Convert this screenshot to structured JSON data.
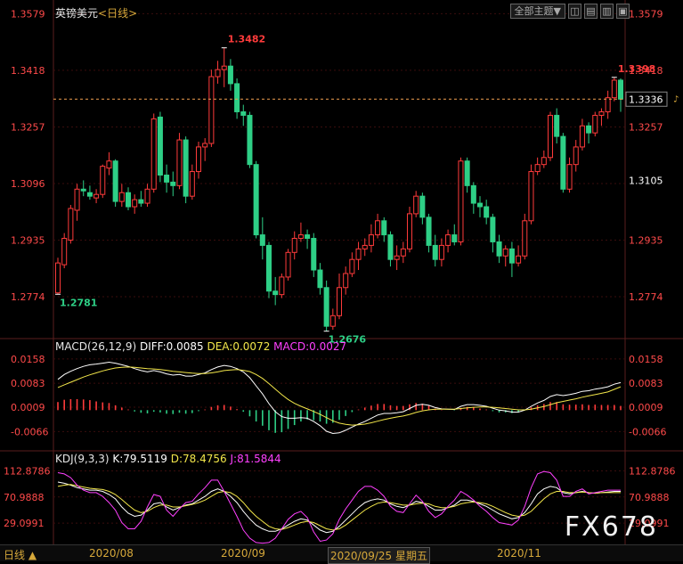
{
  "header": {
    "symbol": "英镑美元",
    "period": "<日线>",
    "theme_button": "全部主题▼",
    "buttons": [
      "◫",
      "▤",
      "▥",
      "▣"
    ]
  },
  "macd_header": {
    "name": "MACD(26,12,9)",
    "diff": "DIFF:0.0085",
    "dea": "DEA:0.0072",
    "macd": "MACD:0.0027"
  },
  "kdj_header": {
    "name": "KDJ(9,3,3)",
    "k": "K:79.5119",
    "d": "D:78.4756",
    "j": "J:81.5844"
  },
  "bottom": {
    "period_label": "日线 ▲",
    "date_labels": [
      "2020/08",
      "2020/09",
      "2020/09/25 星期五",
      "2020/11"
    ]
  },
  "watermark": "FX678",
  "colors": {
    "up": "#ff3b3b",
    "down": "#2ecf86",
    "diff": "#ffffff",
    "dea": "#f2e64a",
    "j": "#ff40ff",
    "grid": "#3a0d0d"
  },
  "chart_data": [
    {
      "type": "candlestick",
      "title": "英镑美元 <日线>",
      "y_ticks": [
        "1.3579",
        "1.3418",
        "1.3257",
        "1.3096",
        "1.2935",
        "1.2774"
      ],
      "ylim": [
        1.266,
        1.358
      ],
      "current_price": "1.3336",
      "price_label_2": "1.3105",
      "annotations": {
        "high": "1.3482",
        "low_left": "1.2781",
        "low": "1.2676",
        "recent_high": "1.3398"
      },
      "candles": [
        [
          1.2785,
          1.287,
          1.278,
          1.2885
        ],
        [
          1.2865,
          1.294,
          1.2855,
          1.2955
        ],
        [
          1.2935,
          1.3025,
          1.2925,
          1.3035
        ],
        [
          1.302,
          1.308,
          1.299,
          1.3095
        ],
        [
          1.308,
          1.3075,
          1.306,
          1.3105
        ],
        [
          1.307,
          1.306,
          1.305,
          1.309
        ],
        [
          1.3055,
          1.3065,
          1.304,
          1.308
        ],
        [
          1.3065,
          1.3145,
          1.3055,
          1.315
        ],
        [
          1.314,
          1.316,
          1.312,
          1.3185
        ],
        [
          1.316,
          1.3045,
          1.303,
          1.3165
        ],
        [
          1.3045,
          1.307,
          1.303,
          1.3095
        ],
        [
          1.307,
          1.303,
          1.302,
          1.3085
        ],
        [
          1.303,
          1.305,
          1.301,
          1.3065
        ],
        [
          1.305,
          1.304,
          1.303,
          1.3075
        ],
        [
          1.304,
          1.308,
          1.303,
          1.3095
        ],
        [
          1.308,
          1.328,
          1.307,
          1.3295
        ],
        [
          1.3285,
          1.312,
          1.31,
          1.33
        ],
        [
          1.312,
          1.31,
          1.307,
          1.315
        ],
        [
          1.31,
          1.309,
          1.306,
          1.313
        ],
        [
          1.309,
          1.322,
          1.308,
          1.324
        ],
        [
          1.322,
          1.306,
          1.304,
          1.323
        ],
        [
          1.306,
          1.313,
          1.305,
          1.315
        ],
        [
          1.313,
          1.32,
          1.311,
          1.3215
        ],
        [
          1.32,
          1.321,
          1.316,
          1.3225
        ],
        [
          1.321,
          1.34,
          1.32,
          1.342
        ],
        [
          1.34,
          1.342,
          1.338,
          1.3445
        ],
        [
          1.342,
          1.343,
          1.337,
          1.3482
        ],
        [
          1.343,
          1.338,
          1.336,
          1.345
        ],
        [
          1.338,
          1.33,
          1.328,
          1.3395
        ],
        [
          1.33,
          1.329,
          1.326,
          1.332
        ],
        [
          1.329,
          1.315,
          1.314,
          1.33
        ],
        [
          1.315,
          1.295,
          1.294,
          1.316
        ],
        [
          1.295,
          1.292,
          1.288,
          1.3
        ],
        [
          1.292,
          1.279,
          1.277,
          1.293
        ],
        [
          1.279,
          1.278,
          1.275,
          1.283
        ],
        [
          1.278,
          1.283,
          1.277,
          1.284
        ],
        [
          1.283,
          1.29,
          1.282,
          1.291
        ],
        [
          1.29,
          1.294,
          1.288,
          1.296
        ],
        [
          1.294,
          1.295,
          1.293,
          1.2985
        ],
        [
          1.295,
          1.294,
          1.291,
          1.2965
        ],
        [
          1.294,
          1.285,
          1.283,
          1.2955
        ],
        [
          1.285,
          1.28,
          1.278,
          1.287
        ],
        [
          1.28,
          1.269,
          1.2676,
          1.282
        ],
        [
          1.269,
          1.272,
          1.268,
          1.274
        ],
        [
          1.272,
          1.28,
          1.271,
          1.284
        ],
        [
          1.28,
          1.284,
          1.278,
          1.286
        ],
        [
          1.284,
          1.288,
          1.283,
          1.29
        ],
        [
          1.288,
          1.291,
          1.285,
          1.293
        ],
        [
          1.291,
          1.292,
          1.289,
          1.294
        ],
        [
          1.292,
          1.295,
          1.29,
          1.298
        ],
        [
          1.295,
          1.299,
          1.294,
          1.301
        ],
        [
          1.299,
          1.295,
          1.293,
          1.3
        ],
        [
          1.295,
          1.288,
          1.286,
          1.296
        ],
        [
          1.288,
          1.289,
          1.285,
          1.292
        ],
        [
          1.289,
          1.291,
          1.287,
          1.293
        ],
        [
          1.291,
          1.301,
          1.29,
          1.303
        ],
        [
          1.301,
          1.306,
          1.3,
          1.3075
        ],
        [
          1.306,
          1.3,
          1.298,
          1.307
        ],
        [
          1.3,
          1.292,
          1.29,
          1.301
        ],
        [
          1.292,
          1.288,
          1.286,
          1.295
        ],
        [
          1.288,
          1.292,
          1.286,
          1.294
        ],
        [
          1.292,
          1.295,
          1.29,
          1.2965
        ],
        [
          1.295,
          1.293,
          1.292,
          1.298
        ],
        [
          1.293,
          1.316,
          1.292,
          1.317
        ],
        [
          1.316,
          1.309,
          1.307,
          1.317
        ],
        [
          1.309,
          1.304,
          1.301,
          1.31
        ],
        [
          1.304,
          1.303,
          1.3,
          1.306
        ],
        [
          1.303,
          1.3,
          1.298,
          1.305
        ],
        [
          1.3,
          1.293,
          1.29,
          1.301
        ],
        [
          1.293,
          1.289,
          1.287,
          1.295
        ],
        [
          1.289,
          1.291,
          1.286,
          1.292
        ],
        [
          1.291,
          1.287,
          1.283,
          1.293
        ],
        [
          1.287,
          1.289,
          1.286,
          1.292
        ],
        [
          1.289,
          1.299,
          1.288,
          1.301
        ],
        [
          1.299,
          1.313,
          1.298,
          1.315
        ],
        [
          1.313,
          1.315,
          1.312,
          1.317
        ],
        [
          1.315,
          1.317,
          1.314,
          1.319
        ],
        [
          1.317,
          1.329,
          1.316,
          1.33
        ],
        [
          1.329,
          1.323,
          1.321,
          1.331
        ],
        [
          1.323,
          1.308,
          1.307,
          1.324
        ],
        [
          1.308,
          1.315,
          1.307,
          1.317
        ],
        [
          1.315,
          1.32,
          1.313,
          1.322
        ],
        [
          1.32,
          1.326,
          1.319,
          1.328
        ],
        [
          1.326,
          1.324,
          1.321,
          1.327
        ],
        [
          1.324,
          1.329,
          1.323,
          1.33
        ],
        [
          1.329,
          1.33,
          1.326,
          1.331
        ],
        [
          1.33,
          1.334,
          1.328,
          1.336
        ],
        [
          1.334,
          1.339,
          1.333,
          1.3398
        ],
        [
          1.339,
          1.3336,
          1.33,
          1.3395
        ]
      ]
    },
    {
      "type": "line",
      "name": "MACD(26,12,9)",
      "y_ticks": [
        "0.0158",
        "0.0083",
        "0.0009",
        "-0.0066"
      ],
      "ylim": [
        -0.012,
        0.0185
      ],
      "series": [
        {
          "name": "DIFF",
          "values": [
            0.0095,
            0.011,
            0.012,
            0.0128,
            0.0135,
            0.014,
            0.0142,
            0.0145,
            0.0148,
            0.0145,
            0.014,
            0.0135,
            0.0128,
            0.0122,
            0.0118,
            0.0122,
            0.0118,
            0.0112,
            0.0108,
            0.011,
            0.0105,
            0.0105,
            0.011,
            0.0115,
            0.0125,
            0.0133,
            0.0138,
            0.0135,
            0.0128,
            0.0118,
            0.01,
            0.0075,
            0.005,
            0.002,
            -0.0005,
            -0.002,
            -0.0025,
            -0.0025,
            -0.0023,
            -0.0025,
            -0.0035,
            -0.0048,
            -0.0065,
            -0.0072,
            -0.007,
            -0.0062,
            -0.0052,
            -0.0043,
            -0.0035,
            -0.0025,
            -0.0015,
            -0.001,
            -0.001,
            -0.0008,
            -0.0005,
            0.0005,
            0.0015,
            0.0018,
            0.0015,
            0.0008,
            0.0004,
            0.0003,
            0.0002,
            0.0012,
            0.0017,
            0.0017,
            0.0015,
            0.0012,
            0.0006,
            0.0,
            -0.0002,
            -0.0006,
            -0.0006,
            0.0,
            0.0012,
            0.0022,
            0.003,
            0.0042,
            0.0048,
            0.0045,
            0.0048,
            0.0052,
            0.0058,
            0.006,
            0.0065,
            0.0068,
            0.0072,
            0.008,
            0.0085
          ]
        },
        {
          "name": "DEA",
          "values": [
            0.007,
            0.0078,
            0.0086,
            0.0094,
            0.0102,
            0.0109,
            0.0115,
            0.0121,
            0.0126,
            0.013,
            0.0132,
            0.0133,
            0.0132,
            0.013,
            0.0128,
            0.0127,
            0.0125,
            0.0123,
            0.012,
            0.0118,
            0.0116,
            0.0114,
            0.0113,
            0.0113,
            0.0115,
            0.0118,
            0.0122,
            0.0124,
            0.0125,
            0.0123,
            0.0119,
            0.011,
            0.0098,
            0.0082,
            0.0065,
            0.0048,
            0.0033,
            0.0021,
            0.0012,
            0.0004,
            -0.0004,
            -0.0013,
            -0.0023,
            -0.0033,
            -0.004,
            -0.0044,
            -0.0046,
            -0.0045,
            -0.0043,
            -0.0039,
            -0.0034,
            -0.0029,
            -0.0025,
            -0.0021,
            -0.0018,
            -0.0013,
            -0.0007,
            -0.0002,
            0.0001,
            0.0003,
            0.0003,
            0.0003,
            0.0003,
            0.0005,
            0.0007,
            0.0009,
            0.001,
            0.001,
            0.0009,
            0.0007,
            0.0005,
            0.0003,
            0.0001,
            0.0001,
            0.0003,
            0.0007,
            0.0011,
            0.0017,
            0.0023,
            0.0027,
            0.0031,
            0.0035,
            0.004,
            0.0044,
            0.0048,
            0.0052,
            0.0056,
            0.0064,
            0.0072
          ]
        },
        {
          "name": "MACD",
          "values": [
            0.0025,
            0.0032,
            0.0034,
            0.0034,
            0.0033,
            0.0031,
            0.0027,
            0.0024,
            0.0022,
            0.0015,
            0.0008,
            0.0002,
            -0.0004,
            -0.0008,
            -0.001,
            -0.0005,
            -0.0007,
            -0.0011,
            -0.0012,
            -0.0008,
            -0.0011,
            -0.0009,
            -0.0003,
            0.0002,
            0.001,
            0.0015,
            0.0016,
            0.0011,
            0.0003,
            -0.0005,
            -0.0019,
            -0.0035,
            -0.0048,
            -0.0062,
            -0.007,
            -0.0068,
            -0.0058,
            -0.0046,
            -0.0035,
            -0.0029,
            -0.0031,
            -0.0035,
            -0.0042,
            -0.0039,
            -0.003,
            -0.0018,
            -0.0006,
            0.0002,
            0.0008,
            0.0014,
            0.0019,
            0.0019,
            0.0015,
            0.0013,
            0.0013,
            0.0018,
            0.0022,
            0.002,
            0.0014,
            0.0005,
            0.0001,
            0.0,
            -0.0001,
            0.0007,
            0.001,
            0.0008,
            0.0005,
            0.0002,
            -0.0003,
            -0.0007,
            -0.0007,
            -0.0009,
            -0.0007,
            -0.0001,
            0.0009,
            0.0015,
            0.0019,
            0.0025,
            0.0025,
            0.0018,
            0.0017,
            0.0017,
            0.0018,
            0.0016,
            0.0017,
            0.0016,
            0.0016,
            0.0016,
            0.0013
          ]
        }
      ]
    },
    {
      "type": "line",
      "name": "KDJ(9,3,3)",
      "y_ticks": [
        "112.8786",
        "70.9888",
        "29.0991"
      ],
      "ylim": [
        -5,
        125
      ],
      "series": [
        {
          "name": "K",
          "values": [
            95,
            93,
            90,
            86,
            84,
            82,
            82,
            80,
            75,
            68,
            55,
            45,
            40,
            42,
            50,
            60,
            62,
            55,
            50,
            54,
            58,
            60,
            66,
            72,
            80,
            84,
            80,
            72,
            62,
            48,
            36,
            26,
            20,
            16,
            16,
            20,
            26,
            32,
            36,
            34,
            26,
            18,
            14,
            16,
            24,
            34,
            44,
            54,
            62,
            66,
            68,
            66,
            60,
            56,
            54,
            58,
            64,
            62,
            56,
            50,
            50,
            54,
            58,
            66,
            66,
            64,
            60,
            56,
            50,
            44,
            40,
            36,
            38,
            46,
            60,
            76,
            84,
            88,
            86,
            78,
            76,
            78,
            80,
            78,
            77,
            78,
            79,
            80,
            80
          ]
        },
        {
          "name": "D",
          "values": [
            88,
            90,
            91,
            89,
            87,
            85,
            84,
            83,
            80,
            75,
            67,
            58,
            50,
            46,
            48,
            54,
            58,
            58,
            55,
            55,
            57,
            59,
            62,
            66,
            72,
            78,
            80,
            78,
            72,
            62,
            50,
            40,
            32,
            24,
            20,
            19,
            22,
            26,
            30,
            32,
            30,
            25,
            20,
            18,
            20,
            26,
            34,
            42,
            50,
            56,
            61,
            63,
            62,
            60,
            58,
            58,
            60,
            61,
            60,
            56,
            54,
            54,
            56,
            60,
            62,
            63,
            62,
            60,
            56,
            51,
            46,
            42,
            40,
            42,
            48,
            58,
            68,
            76,
            80,
            80,
            78,
            78,
            79,
            78,
            77,
            78,
            78,
            78,
            78
          ]
        },
        {
          "name": "J",
          "values": [
            110,
            108,
            102,
            90,
            82,
            78,
            78,
            72,
            62,
            50,
            30,
            20,
            20,
            32,
            55,
            75,
            72,
            50,
            40,
            52,
            62,
            64,
            76,
            86,
            98,
            98,
            80,
            60,
            40,
            18,
            5,
            -2,
            -3,
            -2,
            5,
            20,
            35,
            44,
            48,
            38,
            15,
            0,
            2,
            12,
            35,
            52,
            66,
            80,
            88,
            88,
            82,
            72,
            56,
            48,
            46,
            60,
            74,
            64,
            48,
            38,
            44,
            56,
            66,
            80,
            74,
            66,
            56,
            48,
            38,
            30,
            28,
            26,
            34,
            56,
            86,
            108,
            112,
            110,
            98,
            72,
            72,
            80,
            84,
            76,
            78,
            80,
            82,
            82,
            82
          ]
        }
      ]
    }
  ]
}
